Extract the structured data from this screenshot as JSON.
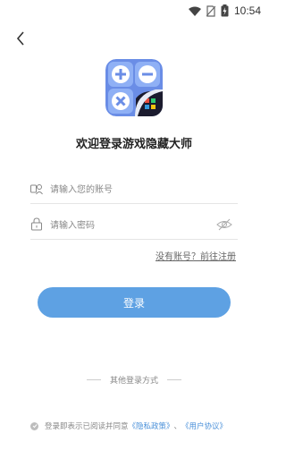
{
  "status_bar": {
    "time": "10:54",
    "battery_icon": "battery-icon",
    "wifi_icon": "wifi-icon",
    "sim_icon": "no-sim-icon"
  },
  "header": {
    "back_icon": "chevron-left-icon"
  },
  "app": {
    "logo_icon": "calculator-hide-logo-icon",
    "welcome_title": "欢迎登录游戏隐藏大师"
  },
  "form": {
    "account_placeholder": "请输入您的账号",
    "password_placeholder": "请输入密码",
    "register_link": "没有账号？前往注册",
    "login_button": "登录"
  },
  "other_login": {
    "label": "其他登录方式"
  },
  "agreement": {
    "prefix": "登录即表示已阅读并同意",
    "privacy": "《隐私政策》",
    "separator": "、",
    "user_agreement": "《用户协议》"
  },
  "colors": {
    "primary": "#5ea1e3",
    "link": "#4a90d9"
  }
}
